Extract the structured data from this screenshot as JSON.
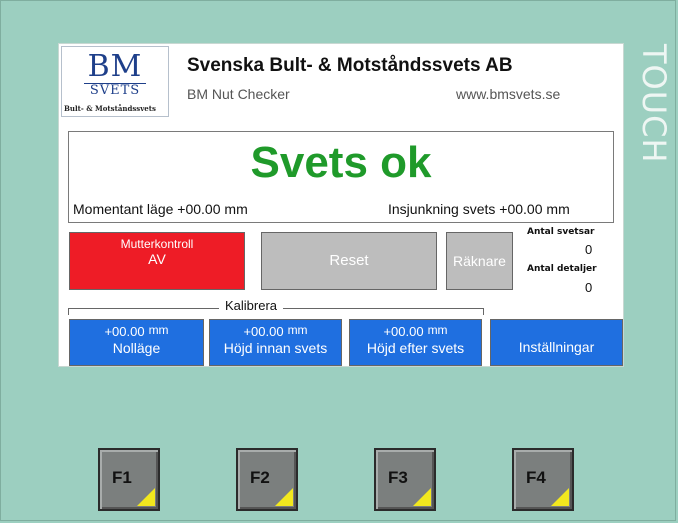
{
  "bezel": {
    "touch_label": "TOUCH"
  },
  "header": {
    "logo_main": "BM",
    "logo_svets": "SVETS",
    "logo_subtitle": "Bult- & Motståndssvets",
    "company_name": "Svenska Bult- & Motståndssvets AB",
    "product_name": "BM Nut Checker",
    "website": "www.bmsvets.se"
  },
  "status": {
    "message": "Svets ok",
    "color": "#1f9a2a",
    "momentary_position_label": "Momentant läge",
    "momentary_position_value": "+00.00",
    "momentary_position_unit": "mm",
    "weld_sink_label": "Insjunkning svets",
    "weld_sink_value": "+00.00",
    "weld_sink_unit": "mm"
  },
  "controls": {
    "nut_control_label": "Mutterkontroll",
    "nut_control_state": "AV",
    "nut_control_color": "#ee1c26",
    "reset_label": "Reset",
    "counter_label": "Räknare",
    "weld_count_label": "Antal svetsar",
    "weld_count_value": "0",
    "part_count_label": "Antal detaljer",
    "part_count_value": "0"
  },
  "calibration": {
    "group_label": "Kalibrera",
    "buttons": [
      {
        "value": "+00.00",
        "unit": "mm",
        "label": "Nolläge"
      },
      {
        "value": "+00.00",
        "unit": "mm",
        "label": "Höjd innan svets"
      },
      {
        "value": "+00.00",
        "unit": "mm",
        "label": "Höjd efter svets"
      }
    ],
    "settings_label": "Inställningar",
    "button_color": "#1f6fe0"
  },
  "function_keys": [
    "F1",
    "F2",
    "F3",
    "F4"
  ]
}
